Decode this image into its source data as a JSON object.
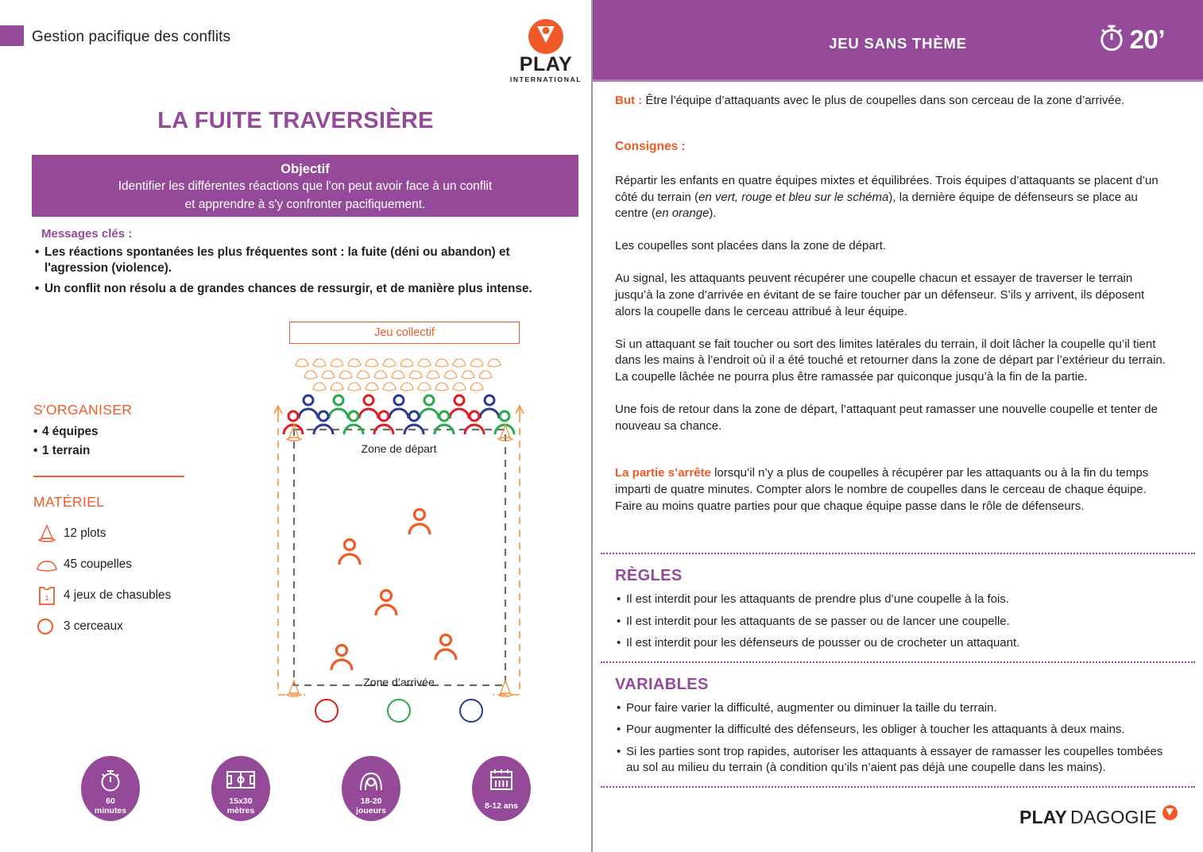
{
  "header": {
    "theme": "Gestion pacifique des conflits",
    "logo_word": "PLAY",
    "logo_sub": "INTERNATIONAL",
    "logo_mark": "play-pin-icon"
  },
  "game": {
    "title": "LA FUITE TRAVERSIÈRE",
    "objectif_label": "Objectif",
    "objectif_line1": "Identifier les différentes réactions que l'on peut avoir face à un conflit",
    "objectif_line2": "et apprendre à s'y confronter pacifiquement."
  },
  "messages": {
    "heading": "Messages clés :",
    "items": [
      "Les réactions spontanées les plus fréquentes sont : la fuite (déni ou abandon) et l'agression (violence).",
      "Un conflit non résolu a de grandes chances de ressurgir, et de manière plus intense."
    ]
  },
  "organiser": {
    "heading": "S'ORGANISER",
    "items": [
      "4 équipes",
      "1 terrain"
    ]
  },
  "materiel": {
    "heading": "MATÉRIEL",
    "items": [
      {
        "icon": "cone-icon",
        "label": "12 plots"
      },
      {
        "icon": "coupelle-icon",
        "label": "45 coupelles"
      },
      {
        "icon": "chasuble-icon",
        "label": "4 jeux de chasubles"
      },
      {
        "icon": "cerceau-icon",
        "label": "3 cerceaux"
      }
    ]
  },
  "diagram": {
    "badge": "Jeu collectif",
    "zone_depart": "Zone de départ",
    "zone_arrivee": "Zone d’arrivée",
    "attacker_colors": [
      "#2b3a8f",
      "#2aa84a",
      "#e11b22"
    ],
    "defender_color": "#f05a28",
    "cerceau_colors": [
      "#e11b22",
      "#2aa84a",
      "#2b3a8f"
    ],
    "coupelle_rows": [
      13,
      12,
      11
    ],
    "defender_count": 5
  },
  "badges": [
    {
      "icon": "stopwatch-icon",
      "line1": "60",
      "line2": "minutes"
    },
    {
      "icon": "field-icon",
      "line1": "15x30",
      "line2": "mètres"
    },
    {
      "icon": "players-icon",
      "line1": "18-20",
      "line2": "joueurs"
    },
    {
      "icon": "calendar-icon",
      "line1": "8-12 ans",
      "line2": ""
    }
  ],
  "right": {
    "header_title": "JEU SANS THÈME",
    "duration": "20’",
    "duration_icon": "stopwatch-icon",
    "but_label": "But :",
    "but_text": " Être l’équipe d’attaquants avec le plus de coupelles dans son cerceau de la zone d’arrivée.",
    "consignes_label": "Consignes :",
    "paragraphs": [
      "Répartir les enfants en quatre équipes mixtes et équilibrées. Trois équipes d’attaquants se placent d’un côté du terrain (en vert, rouge et bleu sur le schéma), la dernière équipe de défenseurs se place au centre (en orange).",
      "Les coupelles sont placées dans la zone de départ.",
      "Au signal, les attaquants peuvent récupérer une coupelle chacun et essayer de traverser le terrain jusqu’à la zone d’arrivée en évitant de se faire toucher par un défenseur. S’ils y arrivent, ils déposent alors la coupelle dans le cerceau attribué à leur équipe.",
      "Si un attaquant se fait toucher ou sort des limites latérales du terrain, il doit lâcher la coupelle qu’il tient dans les mains à l’endroit où il a été touché et retourner dans la zone de départ par l’extérieur du terrain. La coupelle lâchée ne pourra plus être ramassée par quiconque jusqu’à la fin de la partie.",
      "Une fois de retour dans la zone de départ, l’attaquant peut ramasser une nouvelle coupelle et tenter de nouveau sa chance."
    ],
    "italic_fragments": [
      "en vert, rouge et bleu sur le schéma",
      "en orange"
    ],
    "fin_label": "La partie s’arrête",
    "fin_text": " lorsqu’il n’y a plus de coupelles à récupérer par les attaquants ou à la fin du temps imparti de quatre minutes. Compter alors le nombre de coupelles dans le cerceau de chaque équipe. Faire au moins quatre parties pour que chaque équipe passe dans le rôle de défenseurs.",
    "regles_head": "RÈGLES",
    "regles": [
      "Il est interdit pour les attaquants de prendre plus d’une coupelle à la fois.",
      "Il est interdit pour les attaquants de se passer ou de lancer une coupelle.",
      "Il est interdit pour les défenseurs de pousser ou de crocheter un attaquant."
    ],
    "variables_head": "VARIABLES",
    "variables": [
      "Pour faire varier la difficulté, augmenter ou diminuer la taille du terrain.",
      "Pour augmenter la difficulté des défenseurs, les obliger à toucher les attaquants à deux mains.",
      "Si les parties sont trop rapides, autoriser les attaquants à essayer de ramasser les coupelles tombées au sol au milieu du terrain (à condition qu’ils n’aient pas déjà une coupelle dans les mains)."
    ]
  },
  "footer": {
    "brand_bold": "PLAY",
    "brand_light": "DAGOGIE",
    "brand_mark": "play-pin-icon"
  },
  "colors": {
    "purple": "#944a99",
    "orange": "#f05a28",
    "orange_light": "#f5923e",
    "red": "#e11b22",
    "green": "#2aa84a",
    "blue": "#2b3a8f",
    "grey": "#6d6e71",
    "text": "#231f20"
  }
}
